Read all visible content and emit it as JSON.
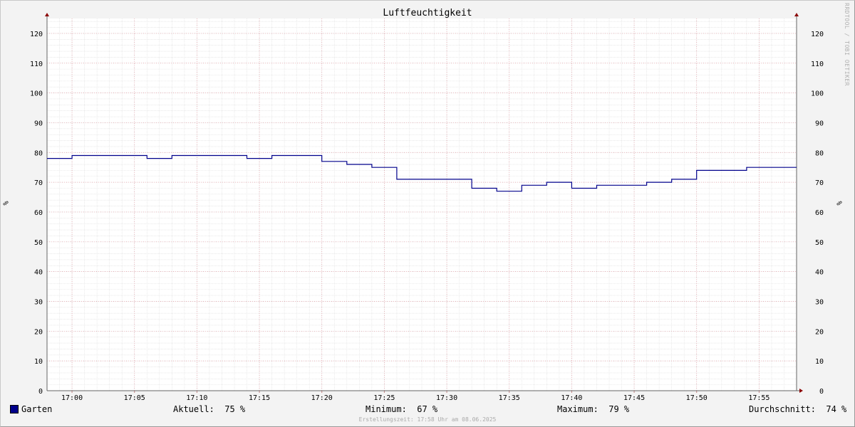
{
  "chart_data": {
    "type": "line",
    "title": "Luftfeuchtigkeit",
    "ylabel": "%",
    "ylim": [
      0,
      125
    ],
    "y_ticks": [
      0,
      10,
      20,
      30,
      40,
      50,
      60,
      70,
      80,
      90,
      100,
      110,
      120
    ],
    "x_tick_labels": [
      "17:00",
      "17:05",
      "17:10",
      "17:15",
      "17:20",
      "17:25",
      "17:30",
      "17:35",
      "17:40",
      "17:45",
      "17:50",
      "17:55"
    ],
    "x_ticks_min": [
      1020,
      1025,
      1030,
      1035,
      1040,
      1045,
      1050,
      1055,
      1060,
      1065,
      1070,
      1075
    ],
    "xlim": [
      1018,
      1078
    ],
    "grid": true,
    "series": [
      {
        "name": "Garten",
        "color": "#00008b",
        "step_points": [
          [
            1018,
            78
          ],
          [
            1020,
            79
          ],
          [
            1026,
            78
          ],
          [
            1028,
            79
          ],
          [
            1034,
            78
          ],
          [
            1036,
            79
          ],
          [
            1040,
            77
          ],
          [
            1042,
            76
          ],
          [
            1044,
            75
          ],
          [
            1046,
            71
          ],
          [
            1052,
            68
          ],
          [
            1054,
            67
          ],
          [
            1056,
            69
          ],
          [
            1058,
            70
          ],
          [
            1060,
            68
          ],
          [
            1062,
            69
          ],
          [
            1066,
            70
          ],
          [
            1068,
            71
          ],
          [
            1070,
            74
          ],
          [
            1074,
            75
          ],
          [
            1078,
            75
          ]
        ]
      }
    ],
    "watermark": "RRDTOOL / TOBI OETIKER"
  },
  "legend": {
    "series_label": "Garten",
    "current_label": "Aktuell:",
    "current_value": "75 %",
    "min_label": "Minimum:",
    "min_value": "67 %",
    "max_label": "Maximum:",
    "max_value": "79 %",
    "avg_label": "Durchschnitt:",
    "avg_value": "74 %"
  },
  "footer": "Erstellungszeit: 17:58 Uhr am 08.06.2025"
}
